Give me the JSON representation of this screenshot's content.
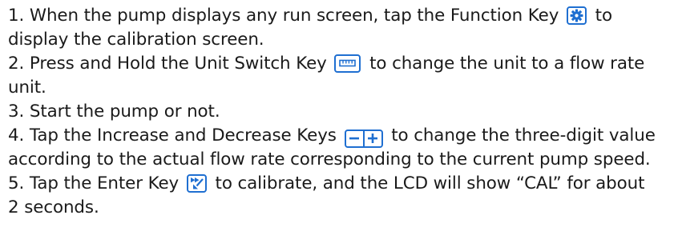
{
  "steps": [
    {
      "lines": [
        [
          "1.  When the pump displays any run screen, tap the Function Key",
          "to"
        ],
        [
          "display the calibration screen."
        ]
      ],
      "icon": "function-key-gear-icon"
    },
    {
      "lines": [
        [
          "2.  Press and Hold the Unit Switch Key",
          "to change the unit to a flow rate"
        ],
        [
          "unit."
        ]
      ],
      "icon": "unit-switch-key-icon"
    },
    {
      "lines": [
        [
          "3. Start the pump or not."
        ]
      ]
    },
    {
      "lines": [
        [
          "4. Tap the Increase and Decrease Keys",
          "to change the three-digit value"
        ],
        [
          "according to the actual flow rate corresponding to the current pump speed."
        ]
      ],
      "icon": "decrease-increase-keys-icon"
    },
    {
      "lines": [
        [
          "5. Tap the Enter Key",
          "to calibrate, and the LCD will show “CAL” for about"
        ],
        [
          "2 seconds."
        ]
      ],
      "icon": "enter-key-icon"
    }
  ],
  "colors": {
    "text": "#1a1a1a",
    "key_blue": "#1f6fd1"
  }
}
